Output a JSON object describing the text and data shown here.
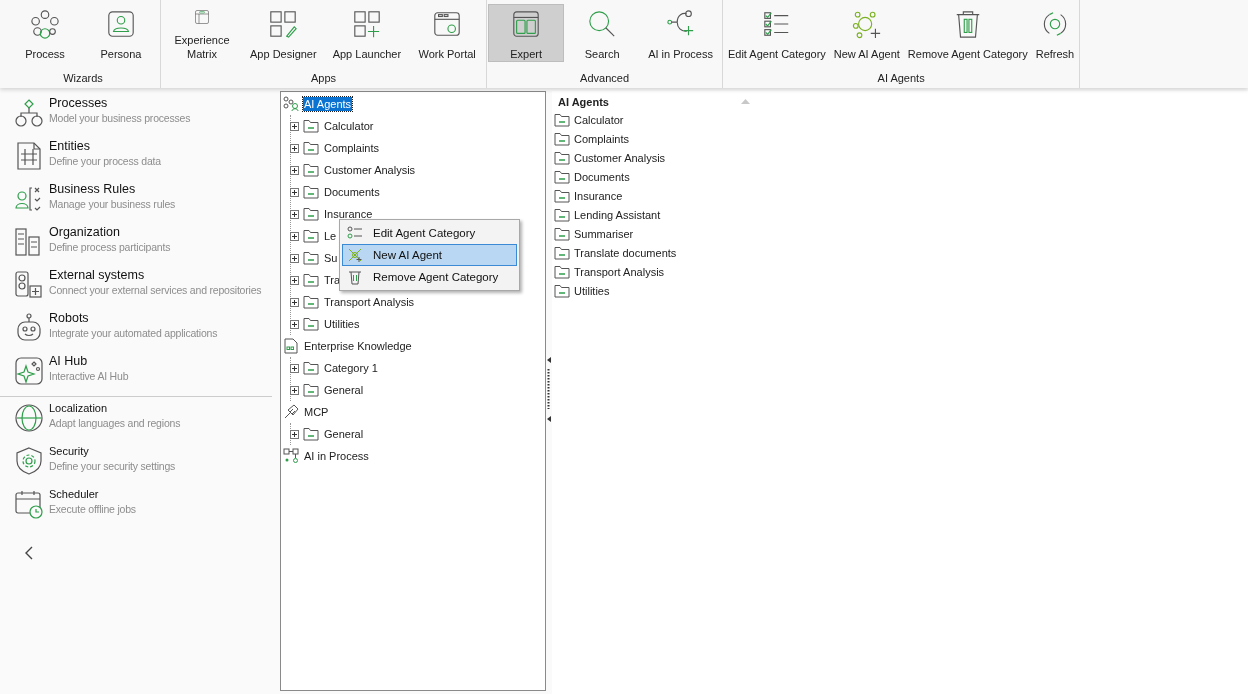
{
  "ribbon": {
    "groups": [
      {
        "label": "Wizards",
        "buttons": [
          {
            "label": "Process",
            "selected": false
          },
          {
            "label": "Persona",
            "selected": false
          }
        ]
      },
      {
        "label": "Apps",
        "buttons": [
          {
            "label": "Experience Matrix",
            "selected": false
          },
          {
            "label": "App Designer",
            "selected": false
          },
          {
            "label": "App Launcher",
            "selected": false
          },
          {
            "label": "Work Portal",
            "selected": false
          }
        ]
      },
      {
        "label": "Advanced",
        "buttons": [
          {
            "label": "Expert",
            "selected": true
          },
          {
            "label": "Search",
            "selected": false
          },
          {
            "label": "AI in Process",
            "selected": false
          }
        ]
      },
      {
        "label": "AI Agents",
        "buttons": [
          {
            "label": "Edit Agent Category",
            "selected": false
          },
          {
            "label": "New AI Agent",
            "selected": false
          },
          {
            "label": "Remove Agent Category",
            "selected": false
          },
          {
            "label": "Refresh",
            "selected": false
          }
        ]
      }
    ]
  },
  "sidebar": {
    "sections": [
      {
        "items": [
          {
            "title": "Processes",
            "subtitle": "Model your business processes"
          },
          {
            "title": "Entities",
            "subtitle": "Define your process data"
          },
          {
            "title": "Business Rules",
            "subtitle": "Manage your business rules"
          },
          {
            "title": "Organization",
            "subtitle": "Define process participants"
          },
          {
            "title": "External systems",
            "subtitle": "Connect your external services and repositories"
          },
          {
            "title": "Robots",
            "subtitle": "Integrate your automated applications"
          },
          {
            "title": "AI Hub",
            "subtitle": "Interactive AI Hub"
          }
        ]
      },
      {
        "items": [
          {
            "title": "Localization",
            "subtitle": "Adapt languages and regions"
          },
          {
            "title": "Security",
            "subtitle": "Define your security settings"
          },
          {
            "title": "Scheduler",
            "subtitle": "Execute offline jobs"
          }
        ]
      }
    ]
  },
  "tree": {
    "items": [
      {
        "label": "AI Agents",
        "selected": true,
        "children": [
          {
            "label": "Calculator",
            "selected": false,
            "expanded": false
          },
          {
            "label": "Complaints",
            "selected": false,
            "expanded": false
          },
          {
            "label": "Customer Analysis",
            "selected": false,
            "expanded": false
          },
          {
            "label": "Documents",
            "selected": false,
            "expanded": false
          },
          {
            "label": "Insurance",
            "selected": false,
            "expanded": false
          },
          {
            "label": "Le",
            "selected": false,
            "expanded": false
          },
          {
            "label": "Su",
            "selected": false,
            "expanded": false
          },
          {
            "label": "Tra",
            "selected": false,
            "expanded": false
          },
          {
            "label": "Transport Analysis",
            "selected": false,
            "expanded": false
          },
          {
            "label": "Utilities",
            "selected": false,
            "expanded": false
          }
        ]
      },
      {
        "label": "Enterprise Knowledge",
        "selected": false,
        "children": [
          {
            "label": "Category 1",
            "selected": false,
            "expanded": false
          },
          {
            "label": "General",
            "selected": false,
            "expanded": false
          }
        ]
      },
      {
        "label": "MCP",
        "selected": false,
        "children": [
          {
            "label": "General",
            "selected": false,
            "expanded": false
          }
        ]
      },
      {
        "label": "AI in Process",
        "selected": false
      }
    ]
  },
  "context_menu": {
    "items": [
      {
        "label": "Edit Agent Category",
        "selected": false
      },
      {
        "label": "New AI Agent",
        "selected": true
      },
      {
        "label": "Remove Agent Category",
        "selected": false
      }
    ]
  },
  "list": {
    "header": "AI Agents",
    "items": [
      "Calculator",
      "Complaints",
      "Customer Analysis",
      "Documents",
      "Insurance",
      "Lending Assistant",
      "Summariser",
      "Translate documents",
      "Transport Analysis",
      "Utilities"
    ]
  }
}
